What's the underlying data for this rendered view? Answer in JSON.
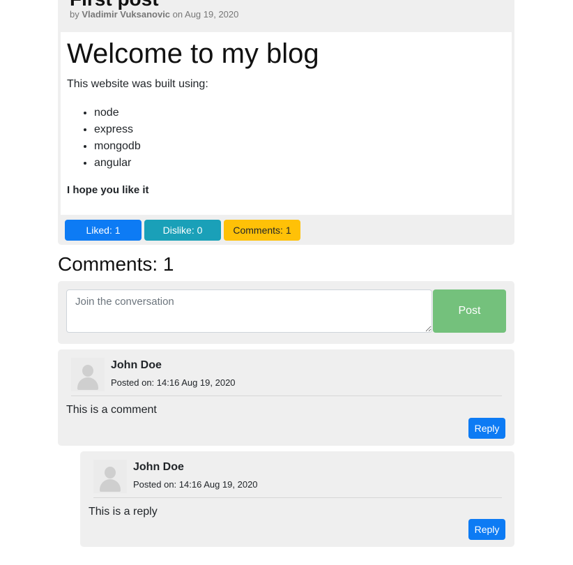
{
  "post": {
    "title": "First post",
    "byline_prefix": "by",
    "author": "Vladimir Vuksanovic",
    "date_text": "on Aug 19, 2020",
    "heading": "Welcome to my blog",
    "intro": "This website was built using:",
    "tech_list": [
      "node",
      "express",
      "mongodb",
      "angular"
    ],
    "outro": "I hope you like it",
    "liked_label": "Liked: 1",
    "dislike_label": "Dislike: 0",
    "comments_label": "Comments: 1"
  },
  "comments_section": {
    "heading": "Comments: 1",
    "input_placeholder": "Join the conversation",
    "post_button": "Post"
  },
  "comments": [
    {
      "author": "John Doe",
      "posted": "Posted on: 14:16 Aug 19, 2020",
      "text": "This is a comment",
      "reply_label": "Reply",
      "replies": [
        {
          "author": "John Doe",
          "posted": "Posted on: 14:16 Aug 19, 2020",
          "text": "This is a reply",
          "reply_label": "Reply"
        }
      ]
    }
  ],
  "colors": {
    "primary": "#0d7bf4",
    "info": "#1aa0b8",
    "warning": "#ffc107",
    "success_muted": "#74c17c",
    "panel": "#efefef"
  },
  "icons": {
    "avatar": "user-placeholder-icon"
  }
}
